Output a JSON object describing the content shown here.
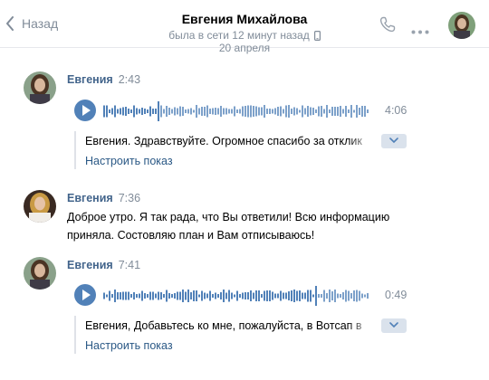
{
  "header": {
    "back_label": "Назад",
    "peer_name": "Евгения Михайлова",
    "peer_status": "была в сети 12 минут назад"
  },
  "date_separator": "20 апреля",
  "messages": [
    {
      "author": "Евгения",
      "time": "2:43",
      "type": "voice",
      "duration": "4:06",
      "progress": 0.2,
      "transcript": "Евгения. Здравствуйте. Огромное спасибо за отклик",
      "settings_link": "Настроить показ"
    },
    {
      "author": "Евгения",
      "time": "7:36",
      "type": "text",
      "lines": [
        "Доброе утро. Я так рада, что Вы ответили! Всю информацию",
        "приняла. Состовляю план и Вам отписываюсь!"
      ]
    },
    {
      "author": "Евгения",
      "time": "7:41",
      "type": "voice",
      "duration": "0:49",
      "progress": 0.8,
      "transcript": "Евгения, Добавьтесь ко мне, пожалуйста, в Вотсап в",
      "settings_link": "Настроить показ"
    }
  ],
  "icons": {
    "back": "chevron-left-icon",
    "call": "phone-icon",
    "more": "more-dots-icon",
    "device": "mobile-device-icon",
    "play": "play-icon",
    "expand": "chevron-down-icon"
  },
  "colors": {
    "accent": "#5181b8",
    "author": "#42648b",
    "link": "#2a5885",
    "muted": "#818c99",
    "wave_bar": "#5181b8"
  }
}
